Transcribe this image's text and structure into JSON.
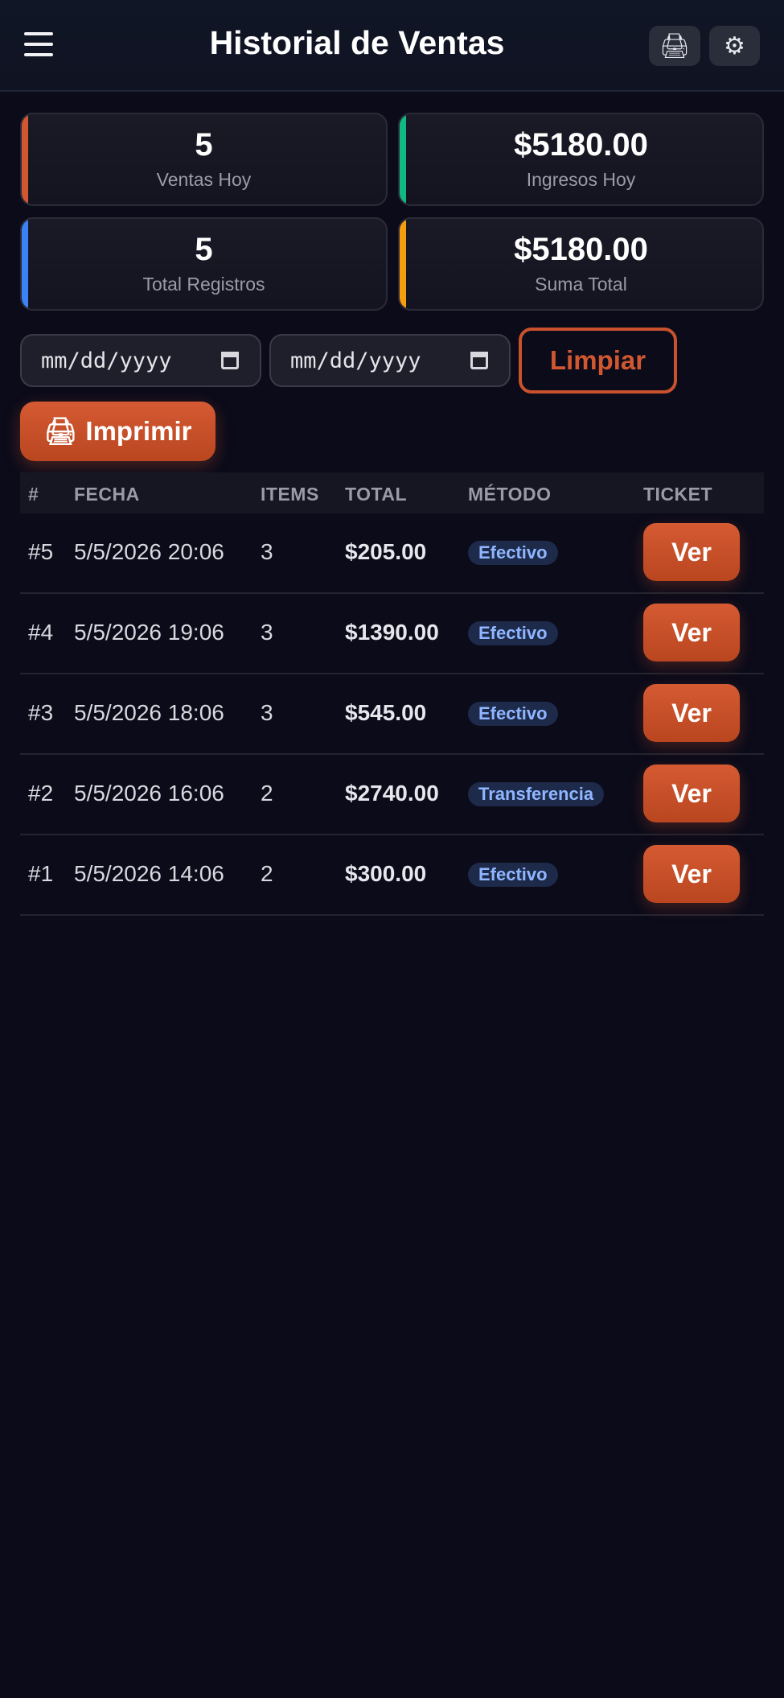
{
  "header": {
    "title": "Historial de Ventas",
    "menu_icon": "hamburger-menu-icon",
    "print_icon": "🖨",
    "settings_icon": "⚙"
  },
  "stats": [
    {
      "value": "5",
      "label": "Ventas Hoy",
      "accent": "#d0572f"
    },
    {
      "value": "$5180.00",
      "label": "Ingresos Hoy",
      "accent": "#10b981"
    },
    {
      "value": "5",
      "label": "Total Registros",
      "accent": "#3b82f6"
    },
    {
      "value": "$5180.00",
      "label": "Suma Total",
      "accent": "#f59e0b"
    }
  ],
  "filters": {
    "date_from_placeholder": "mm/dd/yyyy",
    "date_to_placeholder": "mm/dd/yyyy",
    "clear_label": "Limpiar",
    "print_label": "Imprimir",
    "print_icon": "🖨"
  },
  "table": {
    "headers": [
      "#",
      "FECHA",
      "ITEMS",
      "TOTAL",
      "MÉTODO",
      "TICKET"
    ],
    "rows": [
      {
        "id": "#5",
        "date": "5/5/2026 20:06",
        "items": "3",
        "total": "$205.00",
        "method": "Efectivo",
        "ticket": "Ver"
      },
      {
        "id": "#4",
        "date": "5/5/2026 19:06",
        "items": "3",
        "total": "$1390.00",
        "method": "Efectivo",
        "ticket": "Ver"
      },
      {
        "id": "#3",
        "date": "5/5/2026 18:06",
        "items": "3",
        "total": "$545.00",
        "method": "Efectivo",
        "ticket": "Ver"
      },
      {
        "id": "#2",
        "date": "5/5/2026 16:06",
        "items": "2",
        "total": "$2740.00",
        "method": "Transferencia",
        "ticket": "Ver"
      },
      {
        "id": "#1",
        "date": "5/5/2026 14:06",
        "items": "2",
        "total": "$300.00",
        "method": "Efectivo",
        "ticket": "Ver"
      }
    ]
  },
  "colors": {
    "brand": "#d0572f",
    "background": "#0b0b1a",
    "badge_text": "#8fb6ff"
  }
}
